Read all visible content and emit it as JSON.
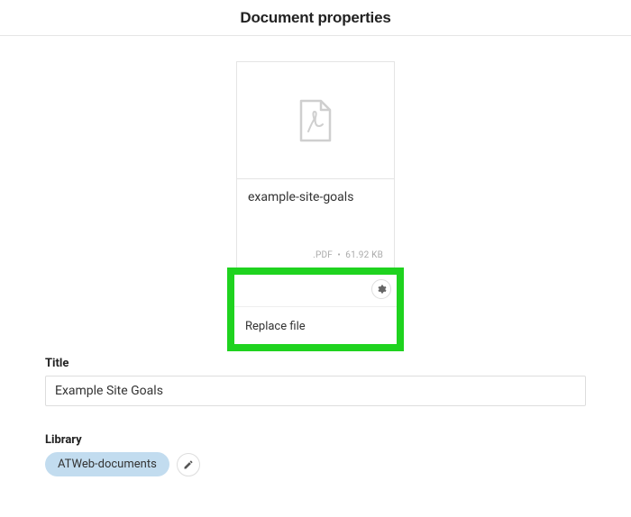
{
  "header": {
    "title": "Document properties"
  },
  "preview": {
    "filename": "example-site-goals",
    "extension": ".PDF",
    "separator": "•",
    "filesize": "61.92 KB"
  },
  "menu": {
    "replace_label": "Replace file"
  },
  "form": {
    "title": {
      "label": "Title",
      "value": "Example Site Goals"
    },
    "library": {
      "label": "Library",
      "value": "ATWeb-documents"
    }
  },
  "icons": {
    "file": "file-pdf-icon",
    "gear": "gear-icon",
    "pencil": "pencil-icon"
  }
}
